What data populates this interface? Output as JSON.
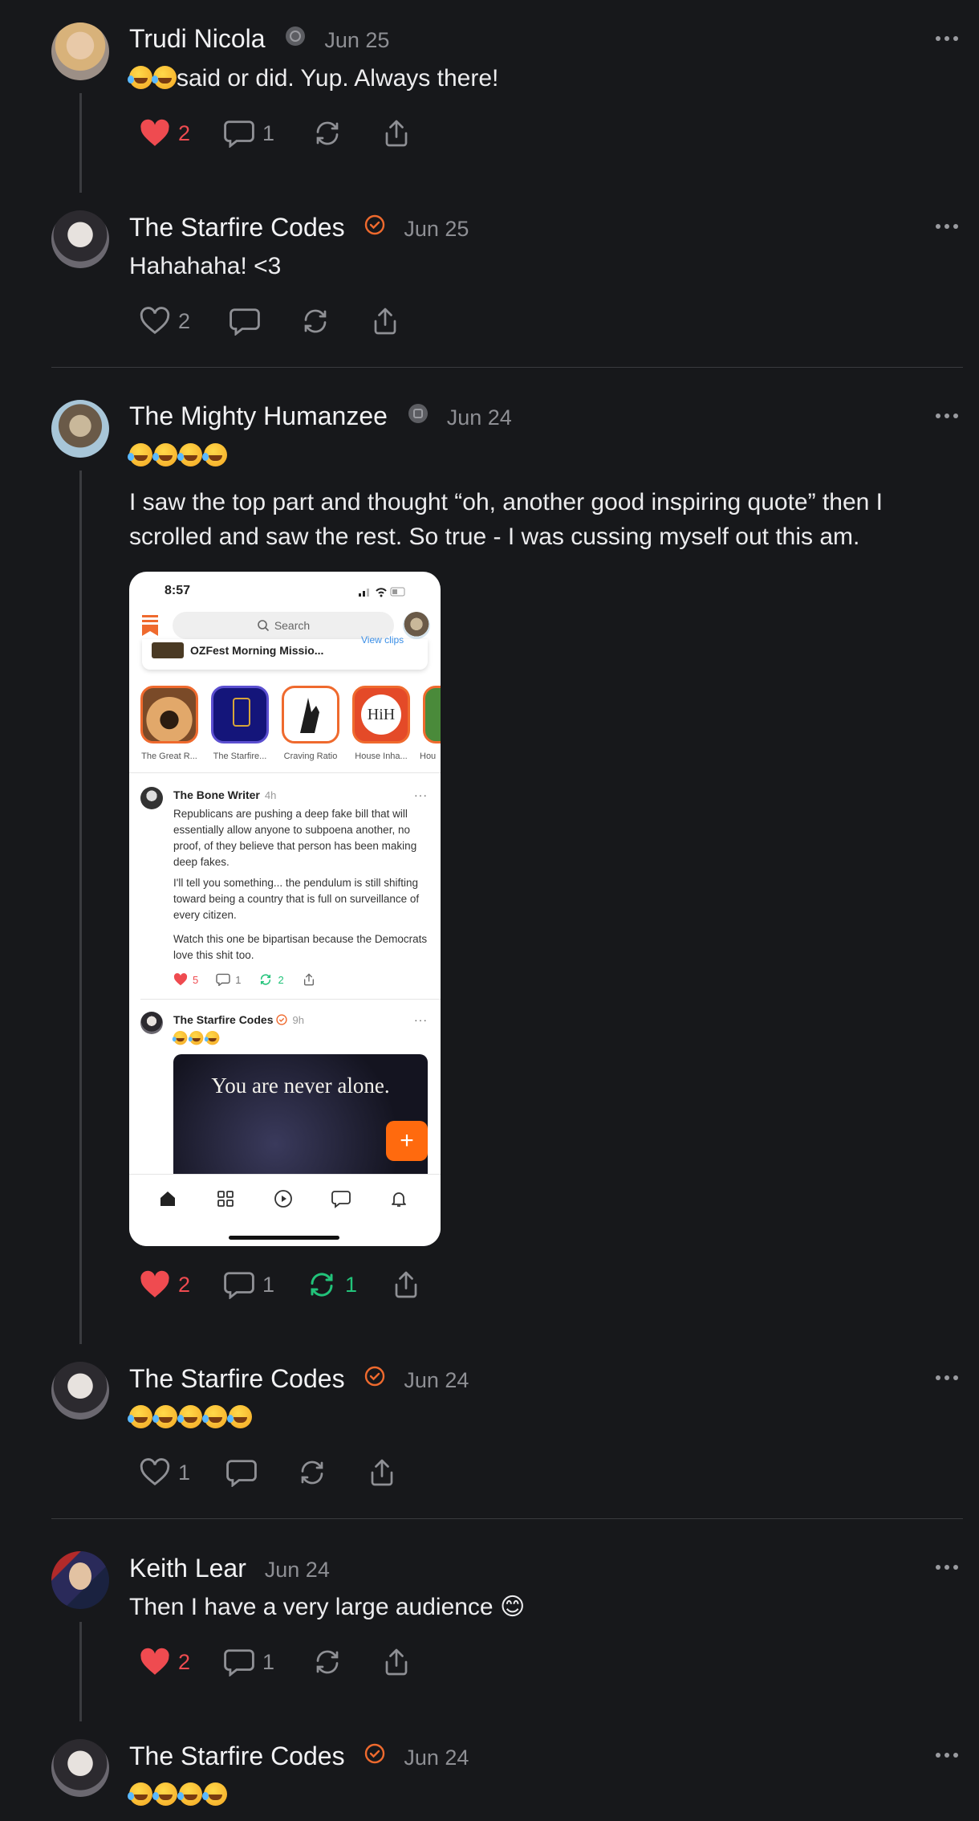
{
  "comments": [
    {
      "author": "Trudi Nicola",
      "date": "Jun 25",
      "text": "said or did. Yup. Always there!",
      "likes": "2",
      "replies": "1",
      "restacks": ""
    },
    {
      "author": "The Starfire Codes",
      "date": "Jun 25",
      "text": "Hahahaha! <3",
      "likes": "2",
      "replies": "",
      "restacks": ""
    },
    {
      "author": "The Mighty Humanzee",
      "date": "Jun 24",
      "text": "I saw the top part and thought “oh, another good inspiring quote” then I scrolled and saw the rest. So true - I was cussing myself out this am.",
      "likes": "2",
      "replies": "1",
      "restacks": "1"
    },
    {
      "author": "The Starfire Codes",
      "date": "Jun 24",
      "likes": "1",
      "replies": "",
      "restacks": ""
    },
    {
      "author": "Keith Lear",
      "date": "Jun 24",
      "text": "Then I have a very large audience 😊",
      "likes": "2",
      "replies": "1",
      "restacks": ""
    },
    {
      "author": "The Starfire Codes",
      "date": "Jun 24"
    }
  ],
  "screenshot": {
    "time": "8:57",
    "search_placeholder": "Search",
    "view_clips": "View clips",
    "pinned_title": "OZFest Morning Missio...",
    "stories": [
      "The Great R...",
      "The Starfire...",
      "Craving Ratio",
      "House Inha...",
      "Hou"
    ],
    "hih": "HiH",
    "post1": {
      "author": "The Bone Writer",
      "time": "4h",
      "p1": "Republicans are pushing a deep fake bill that will essentially allow anyone to subpoena another, no proof, of they believe that person has been making deep fakes.",
      "p2": "I'll tell you something... the pendulum is still shifting toward being a country that is full on surveillance of every citizen.",
      "p3": "Watch this one be bipartisan because the Democrats love this shit too.",
      "likes": "5",
      "replies": "1",
      "restacks": "2"
    },
    "post2": {
      "author": "The Starfire Codes",
      "time": "9h",
      "quote": "You are never alone."
    },
    "fab": "+"
  },
  "colors": {
    "background": "#17181b",
    "accent": "#ef6a2e",
    "like": "#ef4b50",
    "restack": "#22c37a"
  }
}
